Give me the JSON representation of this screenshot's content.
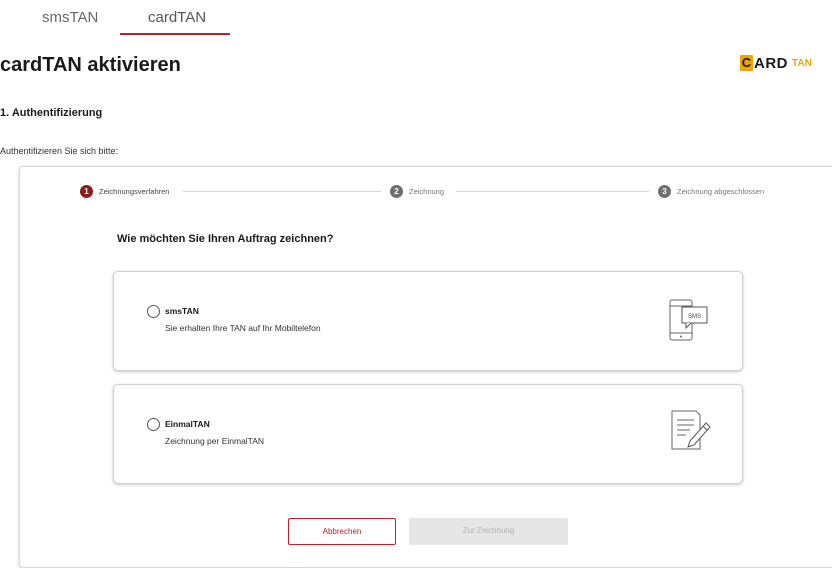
{
  "tabs": [
    {
      "label": "smsTAN"
    },
    {
      "label": "cardTAN"
    }
  ],
  "page": {
    "title": "cardTAN aktivieren",
    "section_title": "1. Authentifizierung",
    "auth_text": "Authentifizieren Sie sich bitte:"
  },
  "logo": {
    "first": "C",
    "rest": "ARD",
    "tan": "TAN"
  },
  "stepper": {
    "steps": [
      {
        "num": "1",
        "label": "Zeichnungsverfahren"
      },
      {
        "num": "2",
        "label": "Zeichnung"
      },
      {
        "num": "3",
        "label": "Zeichnung abgeschlossen"
      }
    ]
  },
  "question": "Wie möchten Sie Ihren Auftrag zeichnen?",
  "options": [
    {
      "title": "smsTAN",
      "desc": "Sie erhalten Ihre TAN auf Ihr Mobiltelefon",
      "icon": "sms-phone-icon",
      "icon_text": "SMS"
    },
    {
      "title": "EinmalTAN",
      "desc": "Zeichnung per EinmalTAN",
      "icon": "document-edit-icon"
    }
  ],
  "buttons": {
    "cancel": "Abbrechen",
    "submit": "Zur Zeichnung"
  },
  "colors": {
    "accent": "#c0202a",
    "step_active": "#8b1c1c",
    "logo_yellow": "#f0a400"
  }
}
